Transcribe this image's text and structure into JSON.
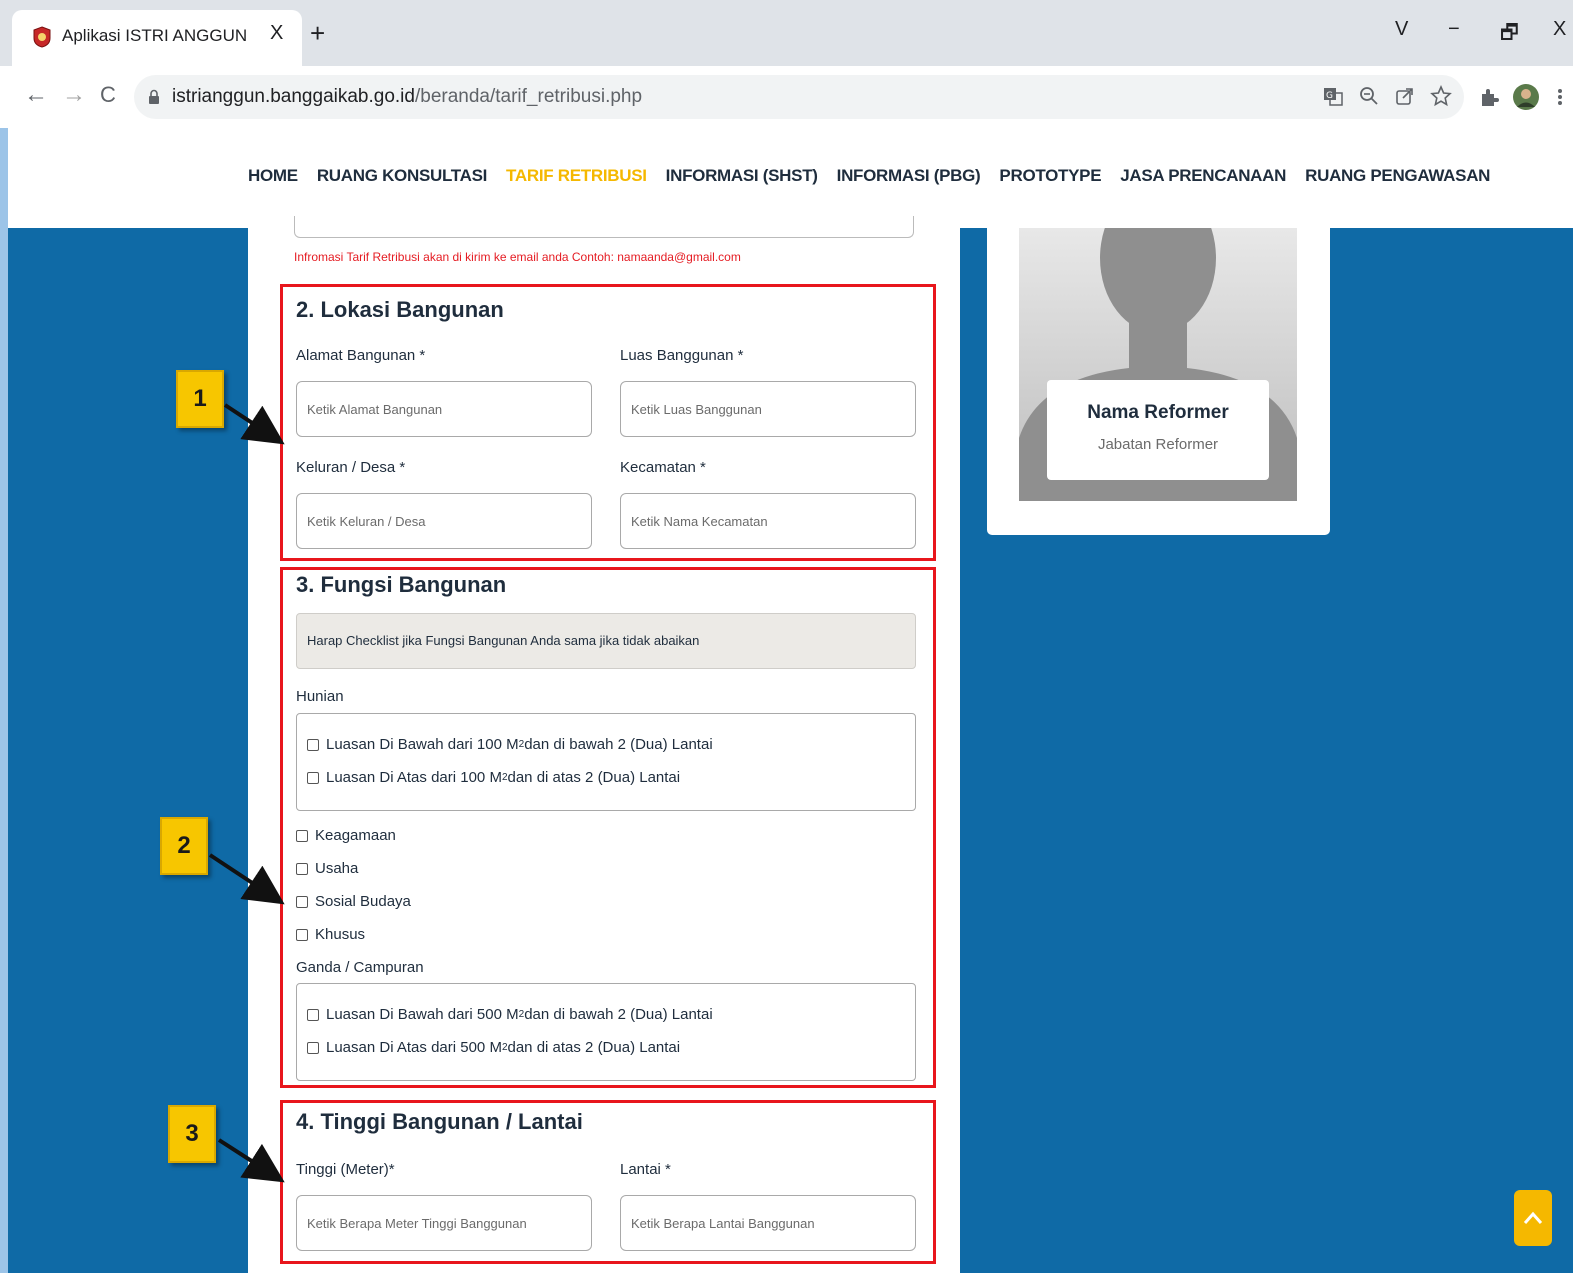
{
  "browser": {
    "tab_title": "Aplikasi ISTRI ANGGUN",
    "tab_close": "X",
    "new_tab": "+",
    "window_controls": {
      "dropdown": "V",
      "minimize": "−",
      "restore": "🗗",
      "close": "X"
    },
    "url_host": "istrianggun.banggaikab.go.id",
    "url_path": "/beranda/tarif_retribusi.php",
    "back": "←",
    "forward": "→",
    "reload": "C"
  },
  "site_nav": {
    "items": [
      {
        "label": "HOME"
      },
      {
        "label": "RUANG KONSULTASI"
      },
      {
        "label": "TARIF RETRIBUSI"
      },
      {
        "label": "INFORMASI (SHST)"
      },
      {
        "label": "INFORMASI (PBG)"
      },
      {
        "label": "PROTOTYPE"
      },
      {
        "label": "JASA PRENCANAAN"
      },
      {
        "label": "RUANG PENGAWASAN"
      }
    ],
    "active_color": "#f5b800"
  },
  "form": {
    "email_hint": "Infromasi Tarif Retribusi akan di kirim ke email anda Contoh: namaanda@gmail.com",
    "lokasi": {
      "title": "2. Lokasi Bangunan",
      "alamat_label": "Alamat Bangunan *",
      "alamat_placeholder": "Ketik Alamat Bangunan",
      "luas_label": "Luas Banggunan *",
      "luas_placeholder": "Ketik Luas Banggunan",
      "kelurahan_label": "Keluran / Desa *",
      "kelurahan_placeholder": "Ketik Keluran / Desa",
      "kecamatan_label": "Kecamatan *",
      "kecamatan_placeholder": "Ketik Nama Kecamatan"
    },
    "fungsi": {
      "title": "3. Fungsi Bangunan",
      "info": "Harap Checklist jika Fungsi Bangunan Anda sama jika tidak abaikan",
      "hunian_label": "Hunian",
      "hunian_options": [
        {
          "pre": "Luasan Di Bawah dari 100 M",
          "sup": "2",
          "post": " dan di bawah 2 (Dua) Lantai"
        },
        {
          "pre": "Luasan Di Atas dari 100 M",
          "sup": "2",
          "post": " dan di atas 2 (Dua) Lantai"
        }
      ],
      "other_options": [
        "Keagamaan",
        "Usaha",
        "Sosial Budaya",
        "Khusus"
      ],
      "ganda_label": "Ganda / Campuran",
      "ganda_options": [
        {
          "pre": "Luasan Di Bawah dari 500 M",
          "sup": "2",
          "post": " dan di bawah 2 (Dua) Lantai"
        },
        {
          "pre": "Luasan Di Atas dari 500 M",
          "sup": "2",
          "post": " dan di atas 2 (Dua) Lantai"
        }
      ]
    },
    "tinggi": {
      "title": "4. Tinggi Bangunan / Lantai",
      "tinggi_label": "Tinggi (Meter)*",
      "tinggi_placeholder": "Ketik Berapa Meter Tinggi Banggunan",
      "lantai_label": "Lantai *",
      "lantai_placeholder": "Ketik Berapa Lantai Banggunan"
    }
  },
  "profile": {
    "name": "Nama Reformer",
    "position": "Jabatan Reformer"
  },
  "annotations": {
    "badge1": "1",
    "badge2": "2",
    "badge3": "3",
    "highlight_color": "#e8161c",
    "badge_color": "#f7c600"
  }
}
